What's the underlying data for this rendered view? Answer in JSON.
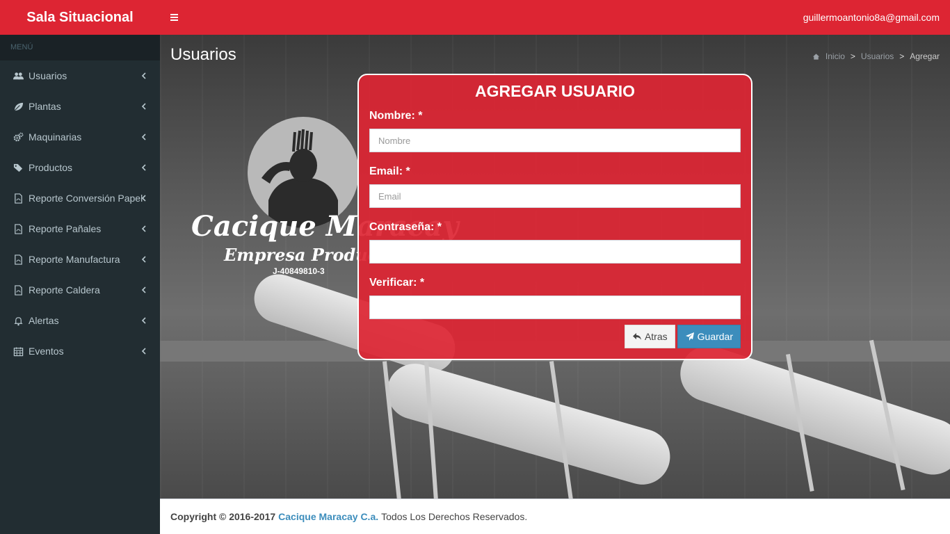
{
  "header": {
    "brand": "Sala Situacional",
    "user_email": "guillermoantonio8a@gmail.com"
  },
  "sidebar": {
    "header": "MENÚ",
    "items": [
      {
        "label": "Usuarios",
        "icon": "users-icon"
      },
      {
        "label": "Plantas",
        "icon": "leaf-icon"
      },
      {
        "label": "Maquinarias",
        "icon": "gears-icon"
      },
      {
        "label": "Productos",
        "icon": "tags-icon"
      },
      {
        "label": "Reporte Conversión Papel",
        "icon": "pdf-file-icon"
      },
      {
        "label": "Reporte Pañales",
        "icon": "pdf-file-icon"
      },
      {
        "label": "Reporte Manufactura",
        "icon": "pdf-file-icon"
      },
      {
        "label": "Reporte Caldera",
        "icon": "pdf-file-icon"
      },
      {
        "label": "Alertas",
        "icon": "bell-icon"
      },
      {
        "label": "Eventos",
        "icon": "calendar-icon"
      }
    ]
  },
  "page": {
    "title": "Usuarios",
    "breadcrumb": [
      "Inicio",
      ">",
      "Usuarios",
      ">",
      "Agregar"
    ]
  },
  "logo": {
    "name": "Cacique Maracay",
    "subtitle": "Empresa Productiva",
    "rif": "J-40849810-3"
  },
  "form": {
    "title": "AGREGAR USUARIO",
    "fields": [
      {
        "label": "Nombre: *",
        "placeholder": "Nombre",
        "value": ""
      },
      {
        "label": "Email: *",
        "placeholder": "Email",
        "value": ""
      },
      {
        "label": "Contraseña: *",
        "placeholder": "",
        "value": ""
      },
      {
        "label": "Verificar: *",
        "placeholder": "",
        "value": ""
      }
    ],
    "back_label": "Atras",
    "save_label": "Guardar"
  },
  "footer": {
    "prefix": "Copyright © 2016-2017",
    "company": "Cacique Maracay C.a.",
    "suffix": "Todos Los Derechos Reservados."
  },
  "colors": {
    "accent": "#dd2533",
    "sidebar": "#222d32",
    "save_button": "#3c8dbc"
  }
}
